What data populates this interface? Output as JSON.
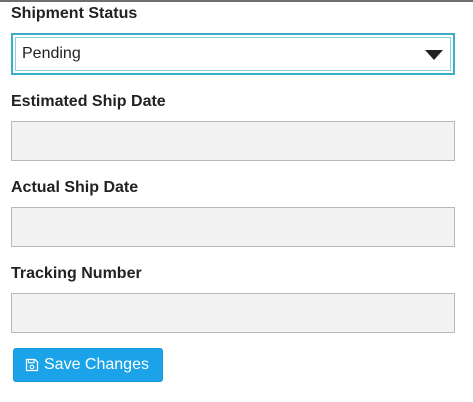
{
  "form": {
    "shipment_status": {
      "label": "Shipment Status",
      "selected": "Pending"
    },
    "estimated_ship_date": {
      "label": "Estimated Ship Date",
      "value": ""
    },
    "actual_ship_date": {
      "label": "Actual Ship Date",
      "value": ""
    },
    "tracking_number": {
      "label": "Tracking Number",
      "value": ""
    },
    "save_button": {
      "label": "Save Changes",
      "icon": "save-icon"
    }
  },
  "colors": {
    "accent": "#1aa3e8",
    "focus_border": "#3aaec8",
    "input_background": "#f2f2f2"
  }
}
